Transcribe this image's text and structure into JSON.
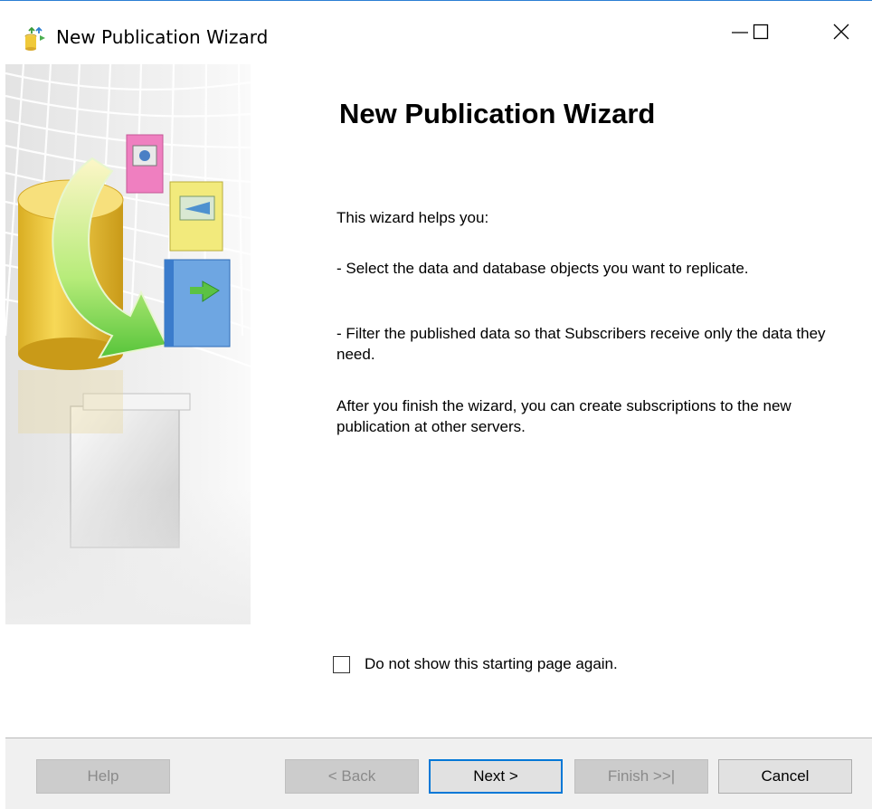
{
  "window": {
    "title": "New Publication Wizard",
    "accent_color": "#0078d7"
  },
  "titlebar": {
    "icon": "publication-wizard-icon",
    "minimize_icon": "minimize-icon",
    "maximize_icon": "maximize-icon",
    "close_icon": "close-icon"
  },
  "content": {
    "heading": "New Publication Wizard",
    "intro": "This wizard helps you:",
    "bullet1": "- Select the data and database objects you want to replicate.",
    "bullet2": "- Filter the published data so that Subscribers receive only the data they need.",
    "after": "After you finish the wizard, you can create subscriptions to the new publication at other servers.",
    "checkbox_label": "Do not show this starting page again.",
    "checkbox_checked": false
  },
  "buttons": {
    "help": "Help",
    "back": "< Back",
    "next": "Next >",
    "finish": "Finish >>|",
    "cancel": "Cancel"
  }
}
